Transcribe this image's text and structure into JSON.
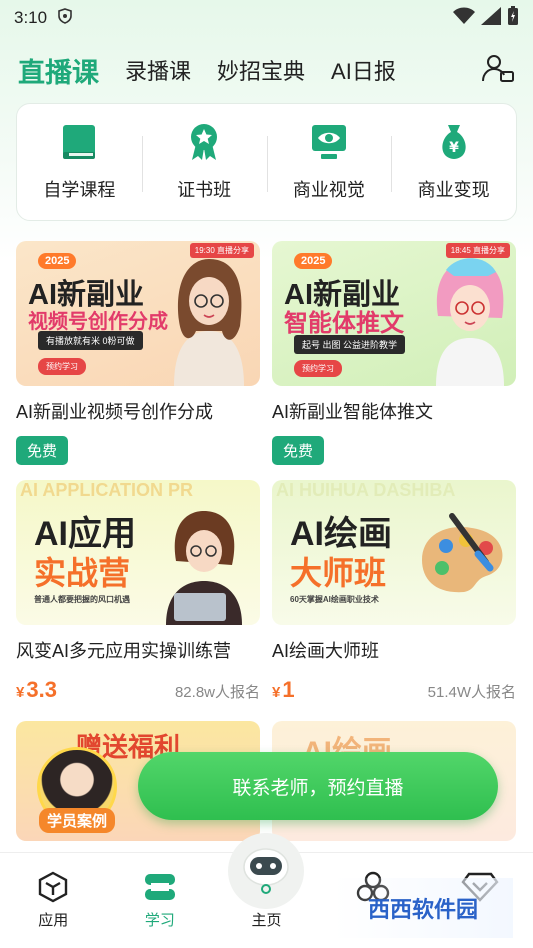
{
  "status": {
    "time": "3:10"
  },
  "top_tabs": [
    "直播课",
    "录播课",
    "妙招宝典",
    "AI日报"
  ],
  "categories": [
    {
      "label": "自学课程",
      "icon": "book-icon"
    },
    {
      "label": "证书班",
      "icon": "award-icon"
    },
    {
      "label": "商业视觉",
      "icon": "eye-monitor-icon"
    },
    {
      "label": "商业变现",
      "icon": "money-bag-icon"
    }
  ],
  "courses": [
    {
      "title": "AI新副业视频号创作分成",
      "badge": "免费",
      "thumb": {
        "year": "2025",
        "time_tag": "19:30 直播分享",
        "line1": "AI新副业",
        "line2": "视频号创作分成",
        "sub": "有播放就有米  0粉可做",
        "btn": "预约学习"
      }
    },
    {
      "title": "AI新副业智能体推文",
      "badge": "免费",
      "thumb": {
        "year": "2025",
        "time_tag": "18:45 直播分享",
        "line1": "AI新副业",
        "line2": "智能体推文",
        "sub": "起号  出图  公益进阶教学",
        "btn": "预约学习"
      }
    },
    {
      "title": "风变AI多元应用实操训练营",
      "price_symbol": "¥",
      "price": "3.3",
      "enroll": "82.8w人报名",
      "thumb": {
        "bg_text": "AI APPLICATION PR",
        "line1": "AI应用",
        "line2": "实战营",
        "sub": "普通人都要把握的风口机遇"
      }
    },
    {
      "title": "AI绘画大师班",
      "price_symbol": "¥",
      "price": "1",
      "enroll": "51.4W人报名",
      "thumb": {
        "bg_text": "AI HUIHUA DASHIBA",
        "line1": "AI绘画",
        "line2": "大师班",
        "sub": "60天掌握AI绘画职业技术"
      }
    }
  ],
  "peek": {
    "left": "赠送福利",
    "right": "AI绘画"
  },
  "float_button": "联系老师，预约直播",
  "avatar_badge": "学员案例",
  "bottom_nav": [
    {
      "label": "应用",
      "icon": "cube-icon"
    },
    {
      "label": "学习",
      "icon": "layers-icon"
    },
    {
      "label": "主页",
      "icon": "robot-icon"
    },
    {
      "label": "",
      "icon": "circles-icon"
    },
    {
      "label": "",
      "icon": "diamond-icon"
    }
  ],
  "watermark": "西西软件园",
  "colors": {
    "brand": "#1fa97a",
    "price": "#f5702a",
    "cta": "#2fbf4f"
  }
}
